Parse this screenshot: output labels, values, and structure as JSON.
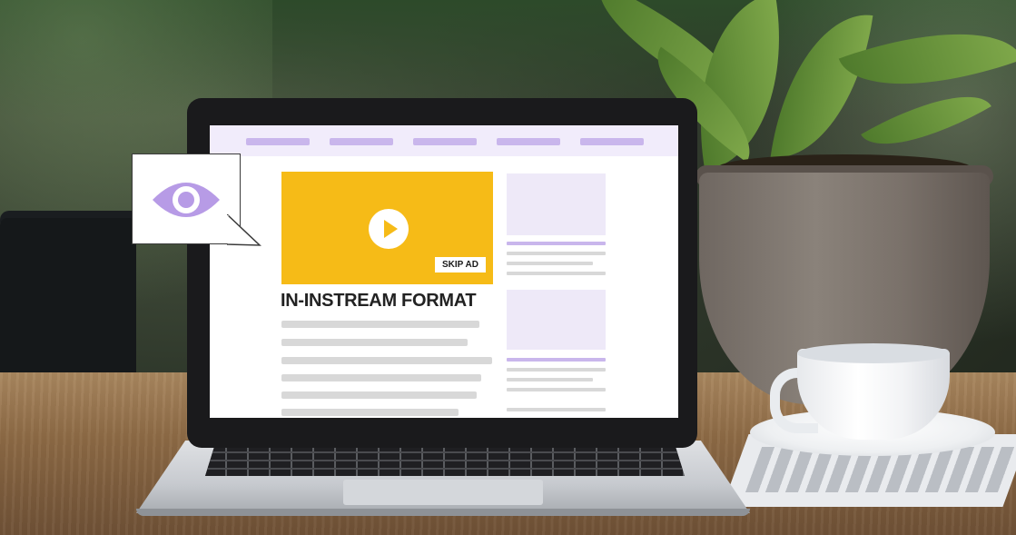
{
  "video_ad": {
    "skip_label": "SKIP AD"
  },
  "article": {
    "headline": "IN-INSTREAM FORMAT"
  },
  "icons": {
    "bubble_icon": "eye-icon",
    "video_icon": "play-icon"
  },
  "colors": {
    "ad_yellow": "#f6bb17",
    "accent_purple": "#b79be6",
    "nav_purple": "#c9b6ec",
    "placeholder_lavender": "#eee9f8"
  }
}
